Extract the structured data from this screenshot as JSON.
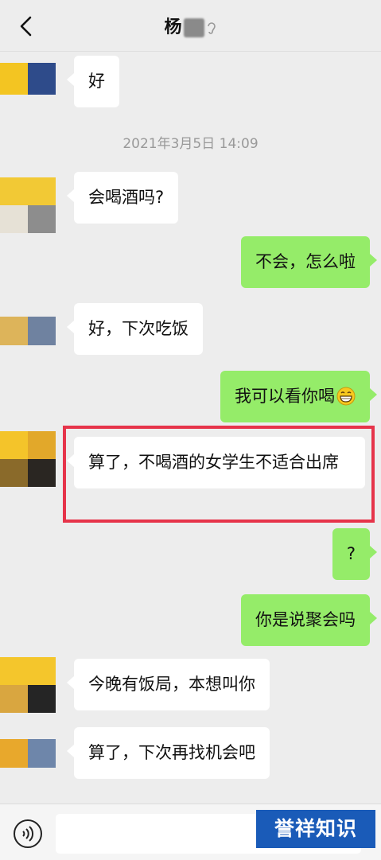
{
  "header": {
    "title": "杨"
  },
  "timestamp": "2021年3月5日 14:09",
  "messages": [
    {
      "side": "left",
      "text": "好"
    },
    {
      "side": "left",
      "text": "会喝酒吗?"
    },
    {
      "side": "right",
      "text": "不会，怎么啦"
    },
    {
      "side": "left",
      "text": "好，下次吃饭"
    },
    {
      "side": "right",
      "text": "我可以看你喝",
      "emoji": "grinning-face-icon"
    },
    {
      "side": "left",
      "text": "算了，不喝酒的女学生不适合出席",
      "highlighted": true
    },
    {
      "side": "right",
      "text": "?"
    },
    {
      "side": "right",
      "text": "你是说聚会吗"
    },
    {
      "side": "left",
      "text": "今晚有饭局，本想叫你"
    },
    {
      "side": "left",
      "text": "算了，下次再找机会吧"
    }
  ],
  "watermark": "誉祥知识",
  "colors": {
    "background": "#ededed",
    "sent_bubble": "#95ec69",
    "received_bubble": "#ffffff",
    "highlight_border": "#e6344a",
    "watermark_bg": "#1a5bb8"
  }
}
